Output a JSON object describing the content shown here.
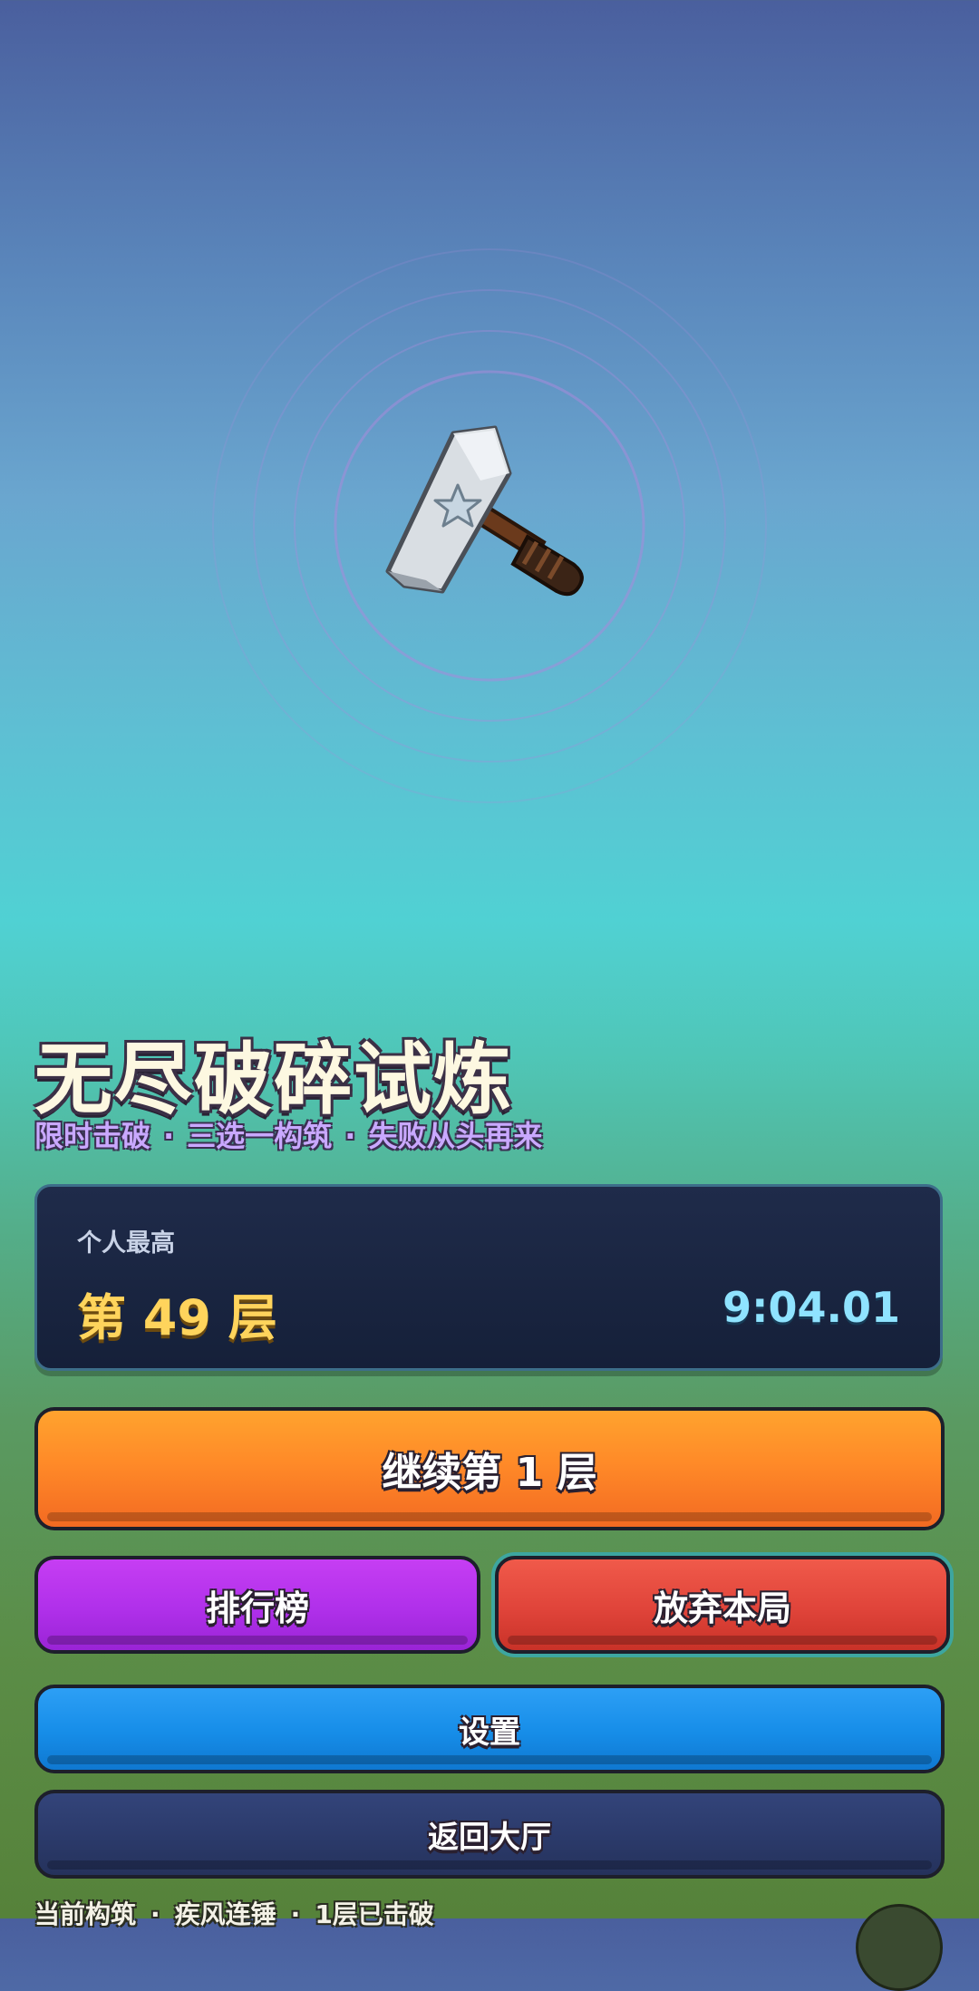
{
  "hero": {
    "item_icon": "hammer-icon",
    "colors": {
      "ring": "#a78bdb",
      "hammer_head": "#d9dee3",
      "handle": "#6b3a1c",
      "grip": "#3b2416"
    }
  },
  "title": "无尽破碎试炼",
  "subtitle": {
    "parts": [
      "限时击破",
      "三选一构筑",
      "失败从头再来"
    ],
    "separator": "·"
  },
  "record": {
    "label": "个人最高",
    "floor": "第 49 层",
    "time": "9:04.01"
  },
  "buttons": {
    "continue": "继续第 1 层",
    "leaderboard": "排行榜",
    "abandon": "放弃本局",
    "settings": "设置",
    "lobby": "返回大厅"
  },
  "status": {
    "parts": [
      "当前构筑",
      "疾风连锤",
      "1层已击破"
    ],
    "separator": "·"
  },
  "colors": {
    "accent_gold": "#ffd45c",
    "accent_cyan": "#8fe3ff",
    "continue": "#ff8a28",
    "leaderboard": "#b030ea",
    "abandon": "#e0443a",
    "settings": "#168de8",
    "lobby": "#2b3a6a"
  }
}
